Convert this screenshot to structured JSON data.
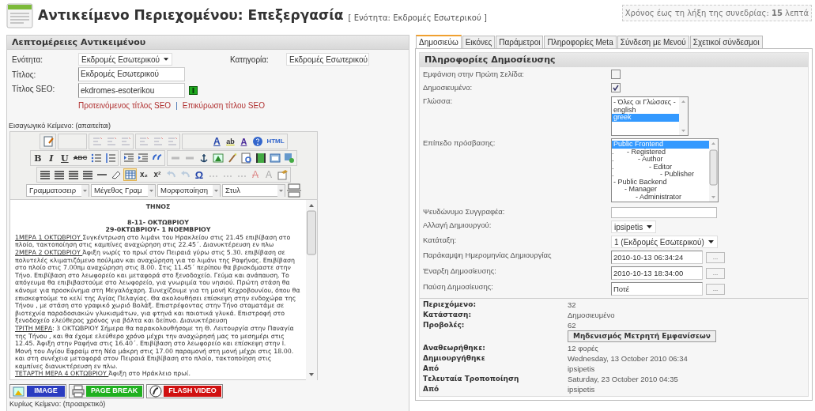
{
  "header": {
    "title": "Αντικείμενο Περιεχομένου: Επεξεργασία",
    "subtitle": "[ Ενότητα: Εκδρομές Εσωτερικού ]",
    "session": "Χρόνος έως τη λήξη της συνεδρίας: **15** λεπτά"
  },
  "details": {
    "title": "Λεπτομέρειες Αντικειμένου",
    "section": {
      "label": "Ενότητα:",
      "value": "Εκδρομές Εσωτερικού"
    },
    "category": {
      "label": "Κατηγορία:",
      "value": "Εκδρομές Εσωτερικού"
    },
    "title_field": {
      "label": "Τίτλος:",
      "value": "Εκδρομές Εσωτερικού"
    },
    "seo": {
      "label": "Τίτλος SEO:",
      "value": "ekdromes-esoterikou",
      "links": [
        "Προτεινόμενος τίτλος SEO",
        "Επικύρωση τίτλου SEO"
      ],
      "separator": "|"
    }
  },
  "intro_label": "Εισαγωγικό Κείμενο: (απαιτείται)",
  "editor": {
    "glyphs": [
      "A",
      "ab",
      "A",
      "HTML",
      "B",
      "I",
      "U",
      "ABC",
      "x₂",
      "x²",
      "Ω",
      "A",
      "A"
    ],
    "dropdowns": [
      "Γραμματοσειρ",
      "Μέγεθος Γραμ",
      "Μορφοποίηση",
      "Στυλ"
    ],
    "headings": [
      "ΤΗΝΟΣ",
      "8-11- ΟΚΤΩΒΡΙΟΥ",
      "29-0ΚΤΩΒΡΙΟΥ- 1 ΝΟΕΜΒΡΙΟΥ"
    ],
    "paragraphs": [
      {
        "lead": "1ΜΕΡΑ 1 ΟΚΤΩΒΡΙΟΥ ",
        "text": "Συγκέντρωση στο λιμάνι του Ηρακλείου στις 21.45 επιβίβαση στο πλοίο, τακτοποίηση στις καμπίνες αναχώρηση στις 22.45΄. Διανυκτέρευση εν πλω"
      },
      {
        "lead": "2ΜΕΡΑ 2 ΟΚΤΩΒΡΙΟΥ ",
        "text": "Άφιξη νωρίς το πρωί στον Πειραιά γύρω στις 5.30. επιβίβαση σε πολυτελές κλιματιζόμενο πούλμαν και αναχώρηση για το λιμάνι της Ραφήνας. Επιβίβαση στο πλοίο στις 7.00πμ αναχώρηση στις 8.00. Στις 11.45΄ περίπου θα βρισκόμαστε στην Τήνο. Επιβίβαση στο λεωφορείο και μεταφορά στο ξενοδοχείο. Γεύμα και ανάπαυση. Το απόγευμα θα επιβιβαστούμε στο λεωφορείο, για γνωριμία του νησιού. Πρώτη στάση θα κάνομε για προσκύνημα στη Μεγαλόχαρη. Συνεχίζουμε για τη μονή Κεχροβουνίου, όπου θα επισκεφτούμε το κελί της Αγίας Πελαγίας. Θα ακολουθήσει επίσκεψη στην ενδοχώρα της Τήνου , με στάση στο γραφικό χωριό Βολάξ. Επιστρέφοντας στην Τήνο σταματάμε σε βιοτεχνία παραδοσιακών γλυκισμάτων, για φτηνά και ποιοτικά γλυκά. Επιστροφή στο ξενοδοχείο ελεύθερος χρόνος για βόλτα και δείπνο. Διανυκτέρευση"
      },
      {
        "lead": "ΤΡΙΤΗ ΜΕΡΑ",
        "text": ": 3 ΟΚΤΩΒΡΙΟΥ Σήμερα θα παρακολουθήσομε τη Θ. Λειτουργία στην Παναγία της Τήνου ,  και θα έχομε ελεύθερο χρόνο μέχρι την αναχώρησή μας το μεσημέρι στις 12.45. Άφιξη στην Ραφήνα στις 16.40΄.  Επιβίβαση στο λεωφορείο και επίσκεψη στην Ι. Μονή του Αγίου Εφραίμ στη Νέα μάκρη στις 17.00 παραμονή στη μονή μέχρι στις 18.00.  και στη  συνέχεια μεταφορά στον Πειραιά Επιβίβαση στο πλοίο, τακτοποίηση στις καμπίνες διανυκτέρευση εν πλω."
      },
      {
        "lead": "ΤΕΤΑΡΤΗ ΜΕΡΑ 4 ΟΚΤΩΒΡΙΟΥ ",
        "text": "Άφιξη στο Ηράκλειο πρωί."
      }
    ],
    "insert_buttons": [
      {
        "kind": "image",
        "label": "IMAGE"
      },
      {
        "kind": "pagebreak",
        "label": "PAGE BREAK"
      },
      {
        "kind": "flash",
        "label": "FLASH VIDEO"
      }
    ]
  },
  "main_label": "Κυρίως Κείμενο: (προαιρετικό)",
  "tabs": [
    {
      "label": "Δημοσιεύω",
      "selected": true
    },
    {
      "label": "Εικόνες",
      "selected": false
    },
    {
      "label": "Παράμετροι",
      "selected": false
    },
    {
      "label": "Πληροφορίες Meta",
      "selected": false
    },
    {
      "label": "Σύνδεση με Μενού",
      "selected": false
    },
    {
      "label": "Σχετικοί σύνδεσμοι",
      "selected": false
    }
  ],
  "publishing": {
    "title": "Πληροφορίες Δημοσίευσης",
    "fields": [
      {
        "kind": "checkbox",
        "label": "Εμφάνιση στην Πρώτη Σελίδα:",
        "checked": false
      },
      {
        "kind": "checkbox",
        "label": "Δημοσιευμένο:",
        "checked": true
      },
      {
        "kind": "listbox",
        "label": "Γλώσσα:",
        "options": [
          {
            "label": "- Όλες οι Γλώσσες -",
            "selected": false
          },
          {
            "label": "english",
            "selected": false
          },
          {
            "label": "greek",
            "selected": true
          }
        ]
      },
      {
        "kind": "tree",
        "label": "Επίπεδο πρόσβασης:",
        "options": [
          {
            "label": "Public Frontend",
            "selected": true,
            "children": [
              {
                "prefix": ".",
                "label": "- Registered",
                "selected": false,
                "children": [
                  {
                    "prefix": ".",
                    "label": "- Author",
                    "selected": false,
                    "children": [
                      {
                        "prefix": ".",
                        "label": "- Editor",
                        "selected": false,
                        "children": [
                          {
                            "prefix": ".",
                            "label": "- Publisher",
                            "selected": false
                          }
                        ]
                      }
                    ]
                  }
                ]
              }
            ]
          },
          {
            "label": "- Public Backend",
            "selected": false,
            "children": [
              {
                "label": "- Manager",
                "selected": false,
                "children": [
                  {
                    "label": "- Administrator",
                    "selected": false
                  }
                ]
              }
            ]
          }
        ]
      },
      {
        "kind": "text",
        "label": "Ψευδώνυμο Συγγραφέα:"
      },
      {
        "kind": "select",
        "label": "Αλλαγή Δημιουργού:",
        "value": "ipsipetis"
      },
      {
        "kind": "select",
        "label": "Κατάταξη:",
        "value": "1 (Εκδρομές Εσωτερικού)"
      },
      {
        "kind": "date",
        "label": "Παράκαμψη Ημερομηνίας Δημιουργίας",
        "value": "2010-10-13 06:34:24",
        "button": "..."
      },
      {
        "kind": "date",
        "label": "Έναρξη Δημοσίευσης:",
        "value": "2010-10-13 18:34:00",
        "button": "..."
      },
      {
        "kind": "date",
        "label": "Παύση Δημοσίευσης:",
        "value": "Ποτέ",
        "button": "..."
      }
    ]
  },
  "info": [
    {
      "label": "Περιεχόμενο:",
      "value": "32"
    },
    {
      "label": "Κατάσταση:",
      "value": "Δημοσιευμένο"
    },
    {
      "label": "Προβολές:",
      "value": "62",
      "button": "Μηδενισμός Μετρητή Εμφανίσεων"
    },
    {
      "label": "Αναθεωρήθηκε:",
      "value": "12 φορές"
    },
    {
      "label": "Δημιουργήθηκε",
      "value": "Wednesday, 13 October 2010 06:34"
    },
    {
      "label": "Από",
      "value": "ipsipetis"
    },
    {
      "label": "Τελευταία Τροποποίηση",
      "value": "Saturday, 23 October 2010 04:35"
    },
    {
      "label": "Από",
      "value": "ipsipetis"
    }
  ]
}
